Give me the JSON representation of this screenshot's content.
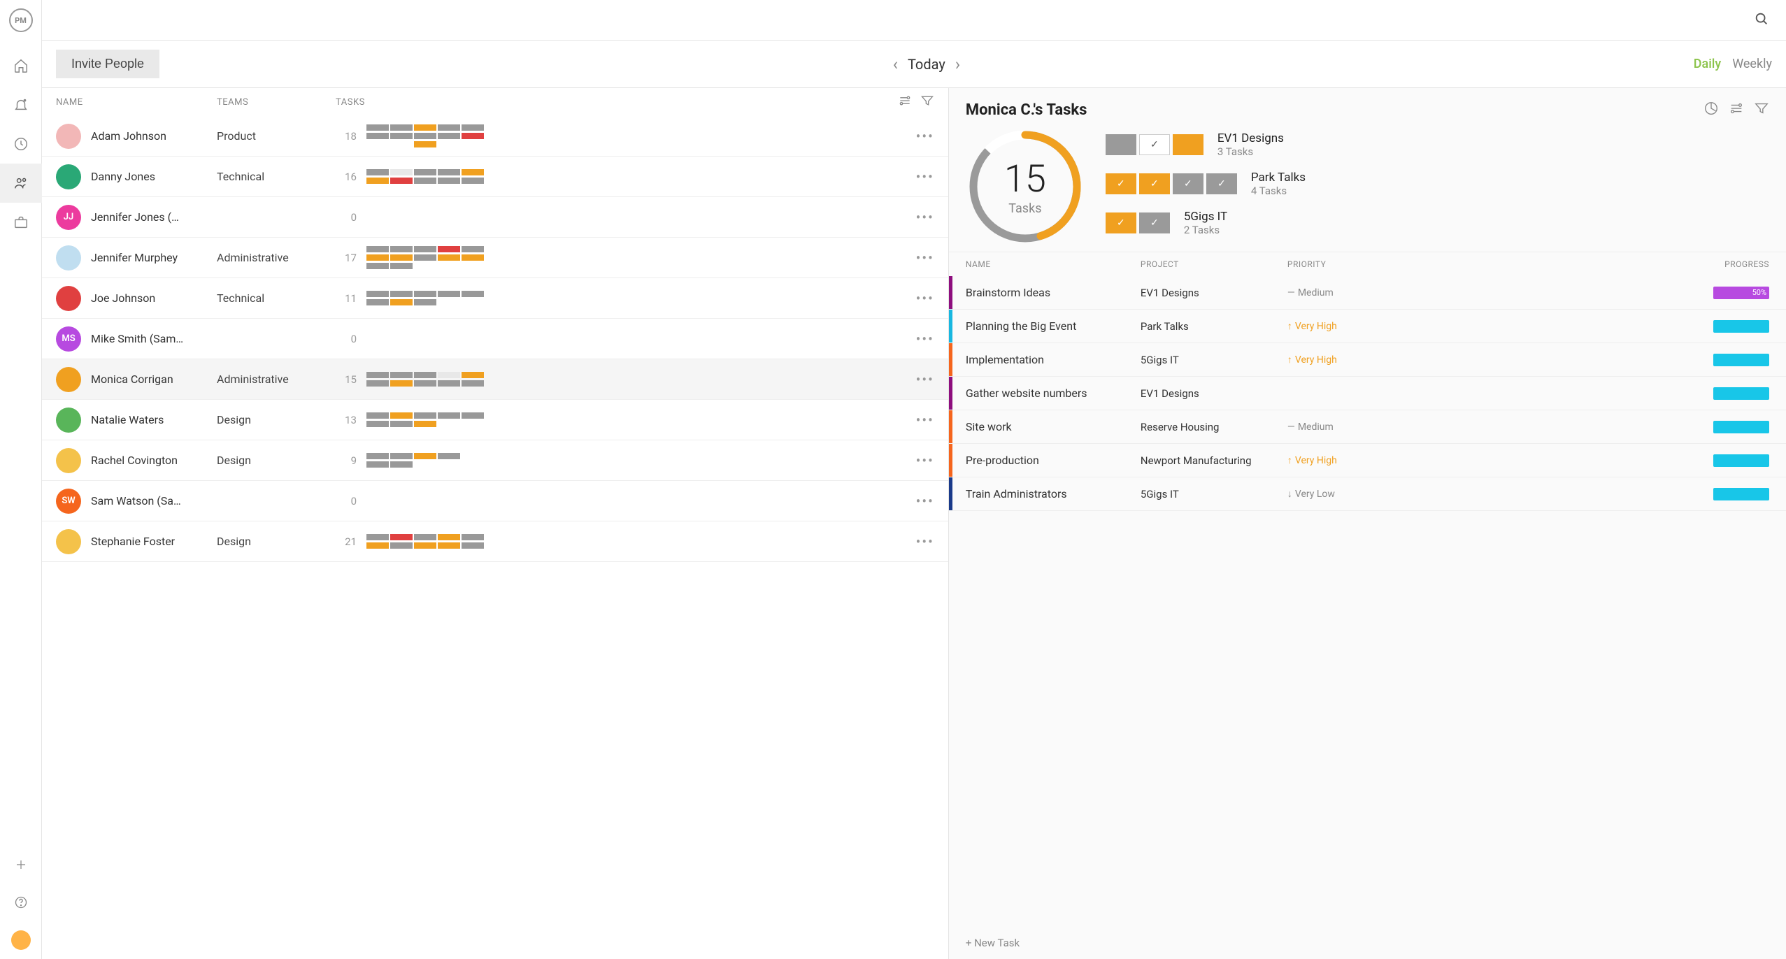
{
  "logo_text": "PM",
  "invite_label": "Invite People",
  "date_label": "Today",
  "view_daily": "Daily",
  "view_weekly": "Weekly",
  "columns": {
    "name": "NAME",
    "teams": "TEAMS",
    "tasks": "TASKS"
  },
  "people": [
    {
      "name": "Adam Johnson",
      "team": "Product",
      "count": "18",
      "avatar_bg": "#f2b7b7",
      "initials": "",
      "chart": [
        [
          "g",
          "g",
          "o",
          "g",
          "g"
        ],
        [
          "g",
          "g",
          "g",
          "g",
          "r"
        ],
        [
          "",
          "",
          "o",
          "",
          ""
        ]
      ],
      "selected": false
    },
    {
      "name": "Danny Jones",
      "team": "Technical",
      "count": "16",
      "avatar_bg": "#2aa876",
      "initials": "",
      "chart": [
        [
          "g",
          "e",
          "g",
          "g",
          "o"
        ],
        [
          "o",
          "r",
          "g",
          "g",
          "g"
        ]
      ],
      "selected": false
    },
    {
      "name": "Jennifer Jones (…",
      "team": "",
      "count": "0",
      "avatar_bg": "#ec3b9e",
      "initials": "JJ",
      "chart": [],
      "selected": false
    },
    {
      "name": "Jennifer Murphey",
      "team": "Administrative",
      "count": "17",
      "avatar_bg": "#c0def0",
      "initials": "",
      "chart": [
        [
          "g",
          "g",
          "g",
          "r",
          "g"
        ],
        [
          "o",
          "o",
          "g",
          "o",
          "o"
        ],
        [
          "g",
          "g",
          "",
          "",
          ""
        ]
      ],
      "selected": false
    },
    {
      "name": "Joe Johnson",
      "team": "Technical",
      "count": "11",
      "avatar_bg": "#e04040",
      "initials": "",
      "chart": [
        [
          "g",
          "g",
          "g",
          "g",
          "g"
        ],
        [
          "g",
          "o",
          "g",
          "",
          ""
        ]
      ],
      "selected": false
    },
    {
      "name": "Mike Smith (Sam…",
      "team": "",
      "count": "0",
      "avatar_bg": "#b74ae0",
      "initials": "MS",
      "chart": [],
      "selected": false
    },
    {
      "name": "Monica Corrigan",
      "team": "Administrative",
      "count": "15",
      "avatar_bg": "#f0a020",
      "initials": "",
      "chart": [
        [
          "g",
          "g",
          "g",
          "e",
          "o"
        ],
        [
          "g",
          "o",
          "g",
          "g",
          "g"
        ]
      ],
      "selected": true
    },
    {
      "name": "Natalie Waters",
      "team": "Design",
      "count": "13",
      "avatar_bg": "#59b55a",
      "initials": "",
      "chart": [
        [
          "g",
          "o",
          "g",
          "g",
          "g"
        ],
        [
          "g",
          "g",
          "o",
          "",
          ""
        ]
      ],
      "selected": false
    },
    {
      "name": "Rachel Covington",
      "team": "Design",
      "count": "9",
      "avatar_bg": "#f4c24a",
      "initials": "",
      "chart": [
        [
          "g",
          "g",
          "o",
          "g",
          ""
        ],
        [
          "g",
          "g",
          "",
          "",
          ""
        ]
      ],
      "selected": false
    },
    {
      "name": "Sam Watson (Sa…",
      "team": "",
      "count": "0",
      "avatar_bg": "#f5651d",
      "initials": "SW",
      "chart": [],
      "selected": false
    },
    {
      "name": "Stephanie Foster",
      "team": "Design",
      "count": "21",
      "avatar_bg": "#f4c24a",
      "initials": "",
      "chart": [
        [
          "g",
          "r",
          "g",
          "o",
          "g"
        ],
        [
          "o",
          "g",
          "o",
          "o",
          "g"
        ]
      ],
      "selected": false
    }
  ],
  "detail": {
    "title": "Monica C.'s Tasks",
    "ring_number": "15",
    "ring_label": "Tasks",
    "projects": [
      {
        "boxes": [
          {
            "style": "gray"
          },
          {
            "style": "white",
            "check": true
          },
          {
            "style": "orange"
          }
        ],
        "name": "EV1 Designs",
        "count": "3 Tasks"
      },
      {
        "boxes": [
          {
            "style": "orange",
            "check": true
          },
          {
            "style": "orange",
            "check": true
          },
          {
            "style": "gray",
            "check": true
          },
          {
            "style": "gray",
            "check": true
          }
        ],
        "name": "Park Talks",
        "count": "4 Tasks"
      },
      {
        "boxes": [
          {
            "style": "orange",
            "check": true
          },
          {
            "style": "gray",
            "check": true
          }
        ],
        "name": "5Gigs IT",
        "count": "2 Tasks"
      }
    ],
    "task_columns": {
      "name": "NAME",
      "project": "PROJECT",
      "priority": "PRIORITY",
      "progress": "PROGRESS"
    },
    "tasks": [
      {
        "accent": "#8e0e7e",
        "name": "Brainstorm Ideas",
        "project": "EV1 Designs",
        "prio_label": "Medium",
        "prio_color": "#888",
        "prio_icon": "—",
        "prog_color": "#b74ae0",
        "prog_text": "50%",
        "prog_width": "100%"
      },
      {
        "accent": "#18b7e0",
        "name": "Planning the Big Event",
        "project": "Park Talks",
        "prio_label": "Very High",
        "prio_color": "#f0a020",
        "prio_icon": "↑",
        "prog_color": "#18c6e8",
        "prog_text": "",
        "prog_width": "100%"
      },
      {
        "accent": "#f5651d",
        "name": "Implementation",
        "project": "5Gigs IT",
        "prio_label": "Very High",
        "prio_color": "#f0a020",
        "prio_icon": "↑",
        "prog_color": "#18c6e8",
        "prog_text": "",
        "prog_width": "100%"
      },
      {
        "accent": "#8e0e7e",
        "name": "Gather website numbers",
        "project": "EV1 Designs",
        "prio_label": "",
        "prio_color": "",
        "prio_icon": "",
        "prog_color": "#18c6e8",
        "prog_text": "",
        "prog_width": "100%"
      },
      {
        "accent": "#f5651d",
        "name": "Site work",
        "project": "Reserve Housing",
        "prio_label": "Medium",
        "prio_color": "#888",
        "prio_icon": "—",
        "prog_color": "#18c6e8",
        "prog_text": "",
        "prog_width": "100%"
      },
      {
        "accent": "#f5651d",
        "name": "Pre-production",
        "project": "Newport Manufacturing",
        "prio_label": "Very High",
        "prio_color": "#f0a020",
        "prio_icon": "↑",
        "prog_color": "#18c6e8",
        "prog_text": "",
        "prog_width": "100%"
      },
      {
        "accent": "#1a3a8a",
        "name": "Train Administrators",
        "project": "5Gigs IT",
        "prio_label": "Very Low",
        "prio_color": "#888",
        "prio_icon": "↓",
        "prog_color": "#18c6e8",
        "prog_text": "",
        "prog_width": "100%"
      }
    ],
    "new_task_label": "+  New Task"
  }
}
